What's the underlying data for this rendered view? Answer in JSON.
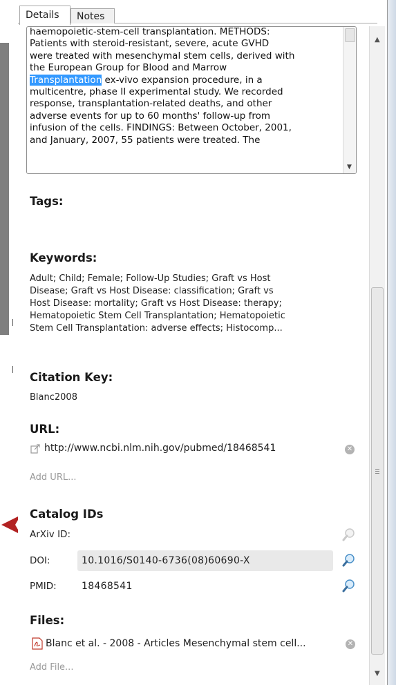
{
  "tabs": [
    {
      "label": "Details",
      "active": true
    },
    {
      "label": "Notes",
      "active": false
    }
  ],
  "abstract": {
    "lines": [
      "haemopoietic-stem-cell transplantation. METHODS:",
      "Patients with steroid-resistant, severe, acute GVHD",
      "were treated with mesenchymal stem cells, derived with",
      "the European Group for Blood and Marrow"
    ],
    "highlight": "Transplantation",
    "highlight_rest": " ex-vivo expansion procedure, in a",
    "lines_after": [
      "multicentre, phase II experimental study. We recorded",
      "response, transplantation-related deaths, and other",
      "adverse events for up to 60 months' follow-up from",
      "infusion of the cells. FINDINGS: Between October, 2001,",
      "and January, 2007, 55 patients were treated. The"
    ]
  },
  "tags": {
    "title": "Tags:"
  },
  "keywords": {
    "title": "Keywords:",
    "lines": [
      "Adult; Child; Female; Follow-Up Studies; Graft vs Host",
      "Disease; Graft vs Host Disease: classification; Graft vs",
      "Host Disease: mortality; Graft vs Host Disease: therapy;",
      "Hematopoietic Stem Cell Transplantation; Hematopoietic",
      "Stem Cell Transplantation: adverse effects; Histocomp..."
    ]
  },
  "citation": {
    "title": "Citation Key:",
    "value": "Blanc2008"
  },
  "url": {
    "title": "URL:",
    "value": "http://www.ncbi.nlm.nih.gov/pubmed/18468541",
    "add_label": "Add URL..."
  },
  "catalog": {
    "title": "Catalog IDs",
    "arxiv_label": "ArXiv ID:",
    "arxiv_value": "",
    "doi_label": "DOI:",
    "doi_value": "10.1016/S0140-6736(08)60690-X",
    "pmid_label": "PMID:",
    "pmid_value": "18468541"
  },
  "files": {
    "title": "Files:",
    "items": [
      {
        "name": "Blanc et al. - 2008 - Articles Mesenchymal stem cell..."
      }
    ],
    "add_label": "Add File..."
  },
  "icons": {
    "external_link": "external-link-icon",
    "clear": "clear-icon",
    "search": "magnifier-icon",
    "pdf": "pdf-icon"
  },
  "colors": {
    "highlight": "#3399ff",
    "arrow": "#b22222",
    "muted_text": "#9a9a9a"
  }
}
